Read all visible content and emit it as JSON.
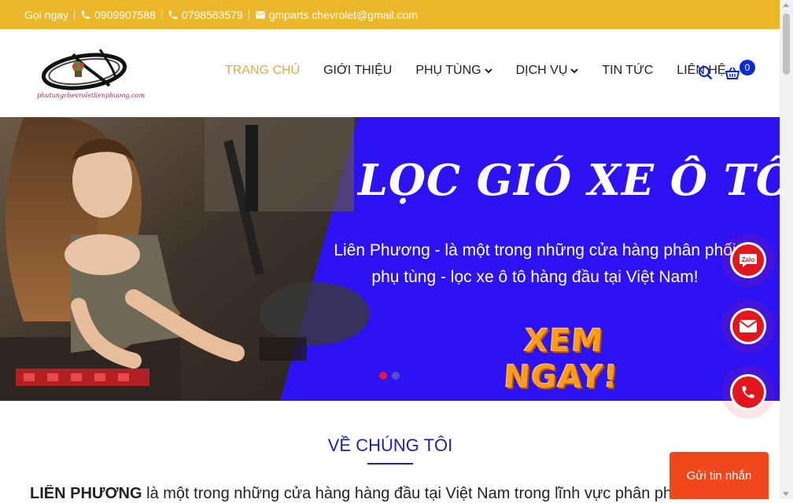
{
  "topbar": {
    "call_label": "Gọi ngay",
    "phone1": "0909907588",
    "phone2": "0798563579",
    "email": "gmparts.chevrolet@gmail.com"
  },
  "logo": {
    "url_text": "phutungchevroletlienphuong.com"
  },
  "nav": {
    "items": [
      {
        "label": "TRANG CHỦ",
        "active": true
      },
      {
        "label": "GIỚI THIỆU"
      },
      {
        "label": "PHỤ TÙNG"
      },
      {
        "label": "DỊCH VỤ"
      },
      {
        "label": "TIN TỨC"
      },
      {
        "label": "LIÊN HỆ"
      }
    ],
    "cart_count": "0"
  },
  "hero": {
    "title": "LỌC GIÓ XE Ô TÔ",
    "desc_line1": "Liên Phương - là một trong những cửa hàng phân phối",
    "desc_line2": "phụ tùng - lọc xe ô tô hàng đầu  tại Việt Nam!",
    "cta": "XEM NGAY!",
    "slides_count": 2,
    "active_slide": 1
  },
  "floating": {
    "zalo_label": "Zalo",
    "send_message": "Gửi tin nhắn"
  },
  "about": {
    "title": "VỀ CHÚNG TÔI",
    "brand": "LIÊN PHƯƠNG",
    "text": " là một trong những cửa hàng hàng đầu tại Việt Nam trong lĩnh vực phân phối"
  },
  "colors": {
    "topbar": "#ebb62a",
    "hero_bg": "#2d12f4",
    "accent_nav": "#e8a93a",
    "brand_blue": "#1a22b6",
    "cta_orange": "#ff9a1a",
    "contact_red": "#e3161e",
    "send_btn": "#f0481a"
  }
}
